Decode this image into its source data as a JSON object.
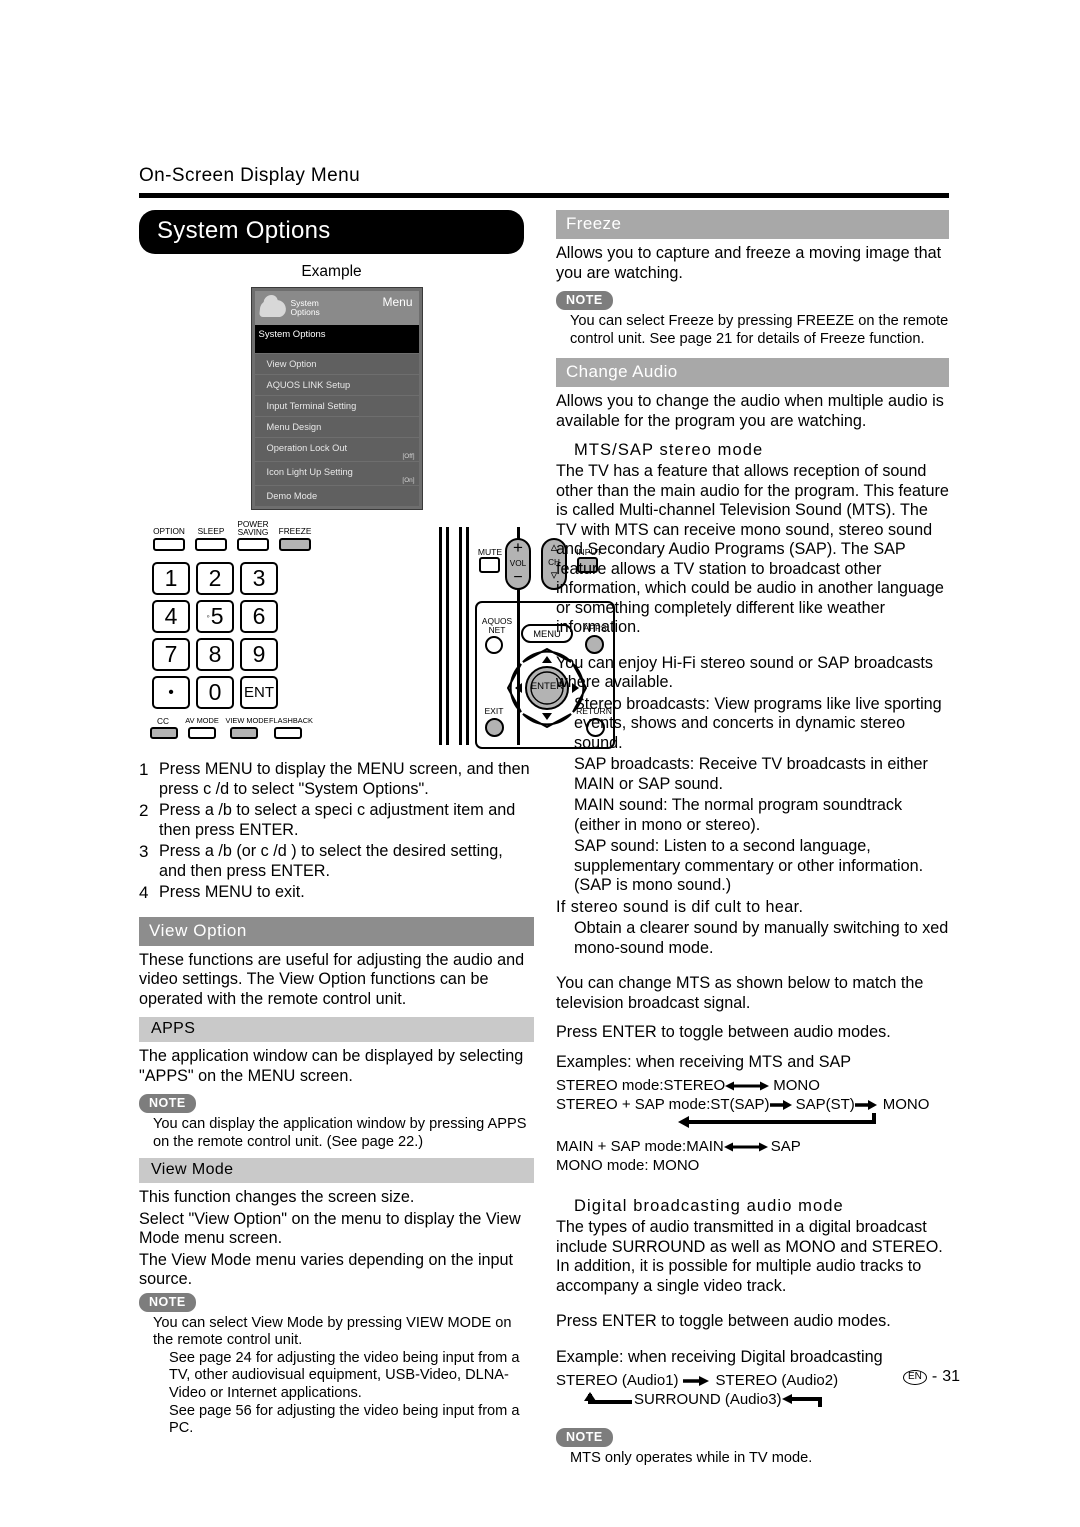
{
  "header": {
    "title": "On-Screen Display Menu"
  },
  "left": {
    "banner": "System Options",
    "example_caption": "Example",
    "osd": {
      "icon_label_line1": "System",
      "icon_label_line2": "Options",
      "menu_word": "Menu",
      "title": "System Options",
      "rows": [
        {
          "label": "View Option",
          "value": ""
        },
        {
          "label": "AQUOS LINK Setup",
          "value": ""
        },
        {
          "label": "Input Terminal Setting",
          "value": ""
        },
        {
          "label": "Menu Design",
          "value": ""
        },
        {
          "label": "Operation Lock Out",
          "value": "[Off]"
        },
        {
          "label": "Icon Light Up Setting",
          "value": "[On]"
        },
        {
          "label": "Demo Mode",
          "value": ""
        }
      ]
    },
    "remote": {
      "top_labels": [
        "OPTION",
        "SLEEP",
        "POWER SAVING",
        "FREEZE"
      ],
      "keypad": [
        "1",
        "2",
        "3",
        "4",
        "5",
        "6",
        "7",
        "8",
        "9",
        "•",
        "0",
        "ENT"
      ],
      "bottom_labels": [
        "CC",
        "AV MODE",
        "VIEW MODE",
        "FLASHBACK"
      ],
      "mute_label": "MUTE",
      "vol_label": "VOL",
      "vol_plus": "+",
      "vol_minus": "−",
      "ch_label": "CH",
      "input_label": "INPUT",
      "aquos_net_line1": "AQUOS",
      "aquos_net_line2": "NET",
      "menu_label": "MENU",
      "apps_label": "APPS",
      "enter_label": "ENTER",
      "exit_label": "EXIT",
      "return_label": "RETURN"
    },
    "steps": [
      {
        "num": "1",
        "text": "Press MENU to display the MENU screen, and then press c /d  to select \"System Options\"."
      },
      {
        "num": "2",
        "text": "Press a /b  to select a speci c adjustment item and then press ENTER."
      },
      {
        "num": "3",
        "text": "Press a /b  (or c /d ) to select the desired setting, and then press ENTER."
      },
      {
        "num": "4",
        "text": "Press MENU to exit."
      }
    ],
    "view_option": {
      "heading": "View Option",
      "body": "These functions are useful for adjusting the audio and video settings. The View Option functions can be operated with the remote control unit."
    },
    "apps": {
      "heading": "APPS",
      "body": "The application window can be displayed by selecting \"APPS\" on the MENU screen.",
      "note_badge": "NOTE",
      "note": "You can display the application window by pressing APPS on the remote control unit. (See page 22.)"
    },
    "view_mode": {
      "heading": "View Mode",
      "body_line1": "This function changes the screen size.",
      "body_line2": "Select \"View Option\" on the menu to display the View Mode menu screen.",
      "body_line3": "The View Mode menu varies depending on the input source.",
      "note_badge": "NOTE",
      "note_line1": "You can select View Mode by pressing VIEW MODE on the remote control unit.",
      "note_line2": "See page 24 for adjusting the video being input from a TV, other audiovisual equipment, USB-Video, DLNA-Video or Internet applications.",
      "note_line3": "See page 56 for adjusting the video being input from a PC."
    }
  },
  "right": {
    "freeze": {
      "heading": "Freeze",
      "body": "Allows you to capture and freeze a moving image that you are watching.",
      "note_badge": "NOTE",
      "note": "You can select Freeze by pressing FREEZE on the remote control unit. See page 21 for details of Freeze function."
    },
    "change_audio": {
      "heading": "Change Audio",
      "body": "Allows you to change the audio when multiple audio is available for the program you are watching.",
      "mts_heading": "MTS/SAP stereo mode",
      "mts_body": "The TV has a feature that allows reception of sound other than the main audio for the program. This feature is called Multi-channel Television Sound (MTS). The TV with MTS can receive mono sound, stereo sound and Secondary Audio Programs (SAP). The SAP feature allows a TV station to broadcast other information, which could be audio in another language or something completely different like weather information.",
      "hifi_body": "You can enjoy Hi-Fi stereo sound or SAP broadcasts where available.",
      "bullets": [
        "Stereo broadcasts: View programs like live sporting events, shows and concerts in dynamic stereo sound.",
        "SAP broadcasts: Receive TV broadcasts in either MAIN or SAP sound.",
        "MAIN sound: The normal program soundtrack (either in mono or stereo).",
        "SAP sound: Listen to a second language, supplementary commentary or other information. (SAP is mono sound.)"
      ],
      "difficult_line": "If stereo sound is dif  cult to hear.",
      "difficult_sub": "Obtain a clearer sound by manually switching to  xed mono-sound mode.",
      "change_mts": "You can change MTS as shown below to match the television broadcast signal.",
      "press_enter": "Press ENTER to toggle between audio modes.",
      "examples_caption": "Examples: when receiving MTS and SAP",
      "diagram": {
        "stereo_label": "STEREO mode:",
        "stereo_a": "STEREO",
        "stereo_b": "MONO",
        "sap_label": "STEREO + SAP mode:",
        "sap_a": "ST(SAP)",
        "sap_b": "SAP(ST)",
        "sap_c": "MONO",
        "main_label": "MAIN + SAP mode:",
        "main_a": "MAIN",
        "main_b": "SAP",
        "mono_line": "MONO mode: MONO"
      }
    },
    "digital": {
      "heading": "Digital broadcasting audio mode",
      "body": "The types of audio transmitted in a digital broadcast include SURROUND as well as MONO and STEREO. In addition, it is possible for multiple audio tracks to accompany a single video track.",
      "press_enter": "Press ENTER to toggle between audio modes.",
      "example_caption": "Example: when receiving Digital broadcasting",
      "diagram": {
        "a": "STEREO (Audio1)",
        "b": "STEREO (Audio2)",
        "c": "SURROUND (Audio3)"
      },
      "note_badge": "NOTE",
      "note": "MTS only operates while in TV mode."
    }
  },
  "footer": {
    "lang": "EN",
    "dash": "-",
    "page": "31"
  }
}
